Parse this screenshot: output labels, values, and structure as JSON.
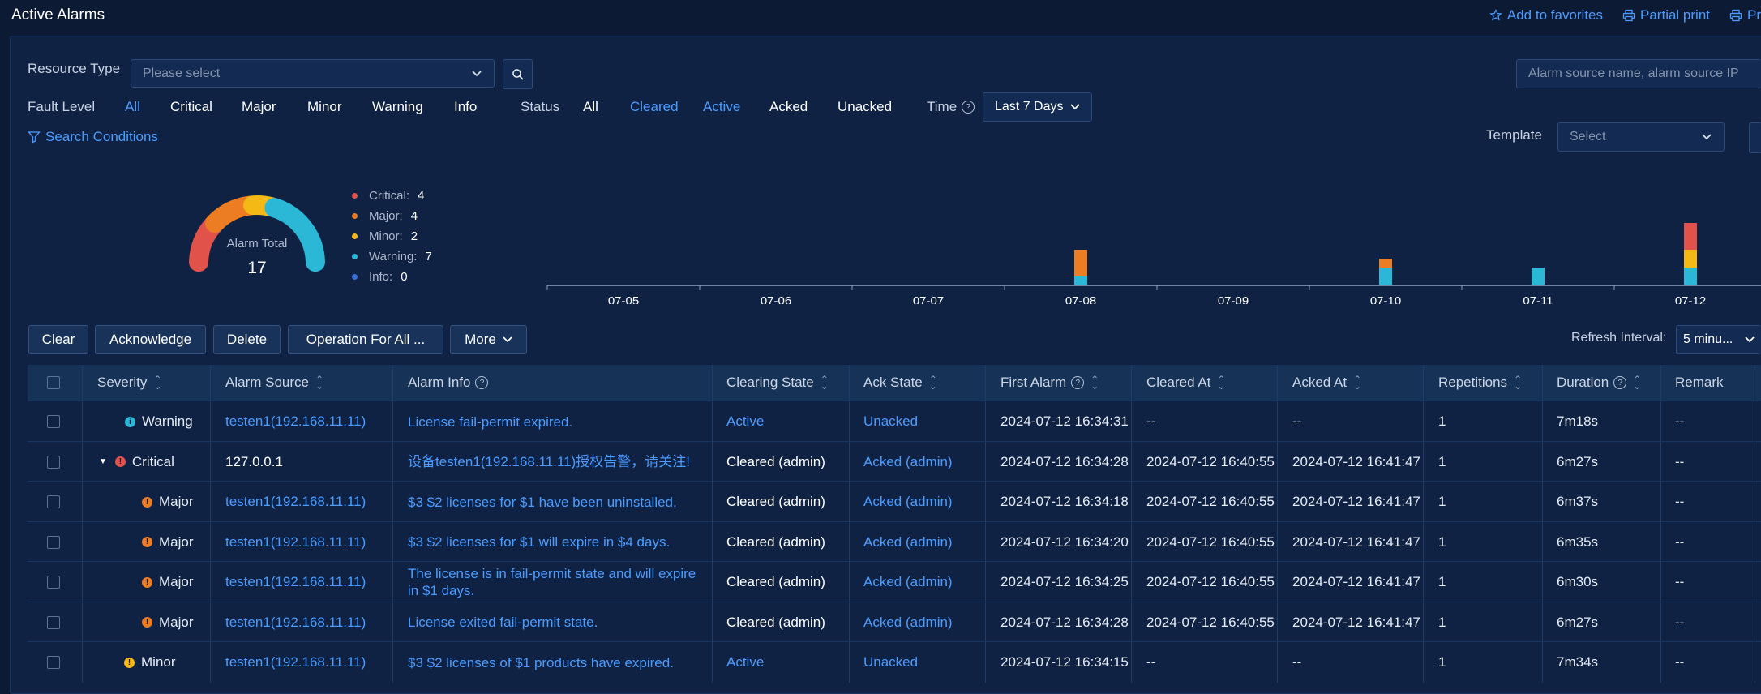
{
  "header": {
    "title": "Active Alarms",
    "actions": [
      "Add to favorites",
      "Partial print",
      "Pr"
    ]
  },
  "filters": {
    "resource_type_label": "Resource Type",
    "resource_type_placeholder": "Please select",
    "search_placeholder": "Alarm source name, alarm source IP",
    "fault_level_label": "Fault Level",
    "fault_levels": [
      "All",
      "Critical",
      "Major",
      "Minor",
      "Warning",
      "Info"
    ],
    "status_label": "Status",
    "statuses": [
      "All",
      "Cleared",
      "Active",
      "Acked",
      "Unacked"
    ],
    "time_label": "Time",
    "time_value": "Last 7 Days",
    "search_conditions": "Search Conditions",
    "template_label": "Template",
    "template_placeholder": "Select"
  },
  "summary": {
    "gauge_label": "Alarm Total",
    "total": "17",
    "legend": [
      {
        "label": "Critical:",
        "count": "4",
        "color": "#e0524a"
      },
      {
        "label": "Major:",
        "count": "4",
        "color": "#ec7d23"
      },
      {
        "label": "Minor:",
        "count": "2",
        "color": "#f5b916"
      },
      {
        "label": "Warning:",
        "count": "7",
        "color": "#2bb8d6"
      },
      {
        "label": "Info:",
        "count": "0",
        "color": "#3b6ed8"
      }
    ]
  },
  "chart_data": {
    "type": "bar",
    "stacked": true,
    "categories": [
      "07-05",
      "07-06",
      "07-07",
      "07-08",
      "07-09",
      "07-10",
      "07-11",
      "07-12"
    ],
    "series": [
      {
        "name": "Warning",
        "color": "#2bb8d6",
        "values": [
          0,
          0,
          0,
          1,
          0,
          2,
          2,
          2
        ]
      },
      {
        "name": "Minor",
        "color": "#f5b916",
        "values": [
          0,
          0,
          0,
          0,
          0,
          0,
          0,
          2
        ]
      },
      {
        "name": "Major",
        "color": "#ec7d23",
        "values": [
          0,
          0,
          0,
          3,
          0,
          1,
          0,
          0
        ]
      },
      {
        "name": "Critical",
        "color": "#e0524a",
        "values": [
          0,
          0,
          0,
          0,
          0,
          0,
          0,
          3
        ]
      }
    ]
  },
  "toolbar": {
    "buttons": [
      "Clear",
      "Acknowledge",
      "Delete",
      "Operation For All ...",
      "More"
    ],
    "refresh_label": "Refresh Interval:",
    "refresh_value": "5 minu..."
  },
  "table": {
    "columns": [
      "Severity",
      "Alarm Source",
      "Alarm Info",
      "Clearing State",
      "Ack State",
      "First Alarm",
      "Cleared At",
      "Acked At",
      "Repetitions",
      "Duration",
      "Remark"
    ],
    "rows": [
      {
        "severity": "Warning",
        "color": "#2bb8d6",
        "icon": "i",
        "source": "testen1(192.168.11.11)",
        "info": "License fail-permit expired.",
        "clearing": "Active",
        "ack": "Unacked",
        "first": "2024-07-12 16:34:31",
        "cleared": "--",
        "acked": "--",
        "reps": "1",
        "duration": "7m18s",
        "remark": "--"
      },
      {
        "severity": "Critical",
        "color": "#e0524a",
        "icon": "!",
        "source": "127.0.0.1",
        "info": "设备testen1(192.168.11.11)授权告警，请关注!",
        "clearing": "Cleared (admin)",
        "ack": "Acked (admin)",
        "first": "2024-07-12 16:34:28",
        "cleared": "2024-07-12 16:40:55",
        "acked": "2024-07-12 16:41:47",
        "reps": "1",
        "duration": "6m27s",
        "remark": "--"
      },
      {
        "severity": "Major",
        "color": "#ec7d23",
        "icon": "!",
        "source": "testen1(192.168.11.11)",
        "info": "$3 $2 licenses for $1 have been uninstalled.",
        "clearing": "Cleared (admin)",
        "ack": "Acked (admin)",
        "first": "2024-07-12 16:34:18",
        "cleared": "2024-07-12 16:40:55",
        "acked": "2024-07-12 16:41:47",
        "reps": "1",
        "duration": "6m37s",
        "remark": "--"
      },
      {
        "severity": "Major",
        "color": "#ec7d23",
        "icon": "!",
        "source": "testen1(192.168.11.11)",
        "info": "$3 $2 licenses for $1 will expire in $4 days.",
        "clearing": "Cleared (admin)",
        "ack": "Acked (admin)",
        "first": "2024-07-12 16:34:20",
        "cleared": "2024-07-12 16:40:55",
        "acked": "2024-07-12 16:41:47",
        "reps": "1",
        "duration": "6m35s",
        "remark": "--"
      },
      {
        "severity": "Major",
        "color": "#ec7d23",
        "icon": "!",
        "source": "testen1(192.168.11.11)",
        "info": "The license is in fail-permit state and will expire in $1 days.",
        "clearing": "Cleared (admin)",
        "ack": "Acked (admin)",
        "first": "2024-07-12 16:34:25",
        "cleared": "2024-07-12 16:40:55",
        "acked": "2024-07-12 16:41:47",
        "reps": "1",
        "duration": "6m30s",
        "remark": "--"
      },
      {
        "severity": "Major",
        "color": "#ec7d23",
        "icon": "!",
        "source": "testen1(192.168.11.11)",
        "info": "License exited fail-permit state.",
        "clearing": "Cleared (admin)",
        "ack": "Acked (admin)",
        "first": "2024-07-12 16:34:28",
        "cleared": "2024-07-12 16:40:55",
        "acked": "2024-07-12 16:41:47",
        "reps": "1",
        "duration": "6m27s",
        "remark": "--"
      },
      {
        "severity": "Minor",
        "color": "#f5b916",
        "icon": "!",
        "source": "testen1(192.168.11.11)",
        "info": "$3 $2 licenses of $1 products have expired.",
        "clearing": "Active",
        "ack": "Unacked",
        "first": "2024-07-12 16:34:15",
        "cleared": "--",
        "acked": "--",
        "reps": "1",
        "duration": "7m34s",
        "remark": "--"
      }
    ]
  }
}
